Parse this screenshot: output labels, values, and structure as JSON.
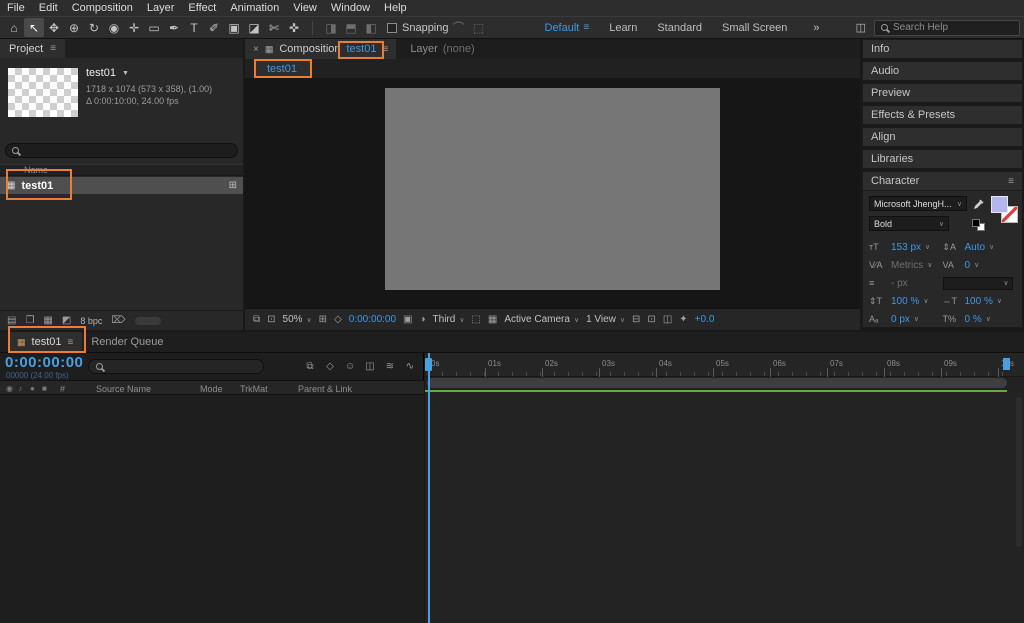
{
  "colors": {
    "accent_blue": "#3f97e5",
    "annotation_orange": "#ed7d31",
    "comp_background_gray": "#767676",
    "cache_green": "#5ab235",
    "fill_swatch": "#b4b4ee"
  },
  "icons": {
    "menu": "≡",
    "close": "×",
    "chevron": "∨",
    "triangle_down": "▼",
    "comp": "▦",
    "folder": "❐",
    "footage": "▤",
    "adjust": "◩",
    "trash": "⌦",
    "screen": "⧉",
    "monitor": "⊡",
    "grid": "⊞",
    "mask": "◇",
    "camera": "▣",
    "channels": "◑",
    "roi": "⬚",
    "share": "⊟",
    "pixel_aspect": "◫",
    "fast": "✦",
    "eye": "◉",
    "audio": "♪",
    "solo": "●",
    "lock": "■",
    "font_size": "тT",
    "leading": "⇕A",
    "kerning": "V∕A",
    "tracking": "VA",
    "stroke_width": "≡",
    "vertical_scale": "⇕T",
    "horizontal_scale": "⇔T",
    "baseline_shift": "Aₐ",
    "tsume": "T%"
  },
  "menu_bar": {
    "items": [
      "File",
      "Edit",
      "Composition",
      "Layer",
      "Effect",
      "Animation",
      "View",
      "Window",
      "Help"
    ]
  },
  "toolbar": {
    "tools": [
      {
        "name": "home-tool",
        "glyph": "⌂",
        "active": false
      },
      {
        "name": "selection-tool",
        "glyph": "↖",
        "active": true
      },
      {
        "name": "hand-tool",
        "glyph": "✥",
        "active": false
      },
      {
        "name": "zoom-tool",
        "glyph": "⊕",
        "active": false
      },
      {
        "name": "rotate-tool",
        "glyph": "↻",
        "active": false
      },
      {
        "name": "camera-tool",
        "glyph": "◉",
        "active": false
      },
      {
        "name": "pan-behind-tool",
        "glyph": "✛",
        "active": false
      },
      {
        "name": "rectangle-tool",
        "glyph": "▭",
        "active": false
      },
      {
        "name": "pen-tool",
        "glyph": "✒",
        "active": false
      },
      {
        "name": "type-tool",
        "glyph": "T",
        "active": false
      },
      {
        "name": "brush-tool",
        "glyph": "✐",
        "active": false
      },
      {
        "name": "clone-stamp-tool",
        "glyph": "▣",
        "active": false
      },
      {
        "name": "eraser-tool",
        "glyph": "◪",
        "active": false
      },
      {
        "name": "roto-brush-tool",
        "glyph": "✄",
        "active": false
      },
      {
        "name": "puppet-pin-tool",
        "glyph": "✜",
        "active": false
      }
    ],
    "option_icons": [
      {
        "name": "fill-options-icon",
        "glyph": "◨"
      },
      {
        "name": "stroke-options-icon",
        "glyph": "⬒"
      },
      {
        "name": "mask-options-icon",
        "glyph": "◧"
      }
    ],
    "snapping_label": "Snapping",
    "snap_icons": [
      {
        "name": "snap-along-edges-icon",
        "glyph": "⌒"
      },
      {
        "name": "snap-features-icon",
        "glyph": "⬚"
      }
    ],
    "workspaces": [
      {
        "label": "Default",
        "active": true
      },
      {
        "label": "Learn",
        "active": false
      },
      {
        "label": "Standard",
        "active": false
      },
      {
        "label": "Small Screen",
        "active": false
      }
    ],
    "workspace_overflow": "»",
    "search": {
      "placeholder": "Search Help"
    }
  },
  "project_panel": {
    "tab": "Project",
    "selected_item": {
      "name": "test01"
    },
    "details": [
      "1718 x 1074  (573 x 358), (1.00)",
      "Δ 0:00:10:00, 24.00 fps"
    ],
    "name_column": "Name",
    "rows": [
      {
        "name": "test01",
        "type": "composition"
      }
    ],
    "bit_depth": "8 bpc"
  },
  "composition_panel": {
    "tab_label": "Composition",
    "tab_comp_name": "test01",
    "layer_tab_label": "Layer",
    "layer_tab_value": "(none)",
    "viewer_tab": "test01",
    "zoom": "50%",
    "timecode": "0:00:00:00",
    "resolution": "Third",
    "camera": "Active Camera",
    "view_layout": "1 View",
    "exposure": "+0.0"
  },
  "right_panels": {
    "collapsed": [
      "Info",
      "Audio",
      "Preview",
      "Effects & Presets",
      "Align",
      "Libraries"
    ]
  },
  "character_panel": {
    "title": "Character",
    "font_family": "Microsoft JhengH...",
    "font_style": "Bold",
    "font_size": "153 px",
    "leading": "Auto",
    "kerning": "Metrics",
    "tracking": "0",
    "stroke_width": "- px",
    "vertical_scale": "100 %",
    "horizontal_scale": "100 %",
    "baseline_shift": "0 px",
    "tsume": "0 %"
  },
  "timeline": {
    "comp_tab": "test01",
    "render_queue_tab": "Render Queue",
    "timecode": "0:00:00:00",
    "frame_info": "00000 (24.00 fps)",
    "feature_icons": [
      {
        "name": "composition-mini-flowchart-icon",
        "glyph": "⧉"
      },
      {
        "name": "draft-3d-icon",
        "glyph": "◇"
      },
      {
        "name": "hide-shy-layers-icon",
        "glyph": "☺"
      },
      {
        "name": "frame-blending-icon",
        "glyph": "◫"
      },
      {
        "name": "motion-blur-icon",
        "glyph": "≋"
      },
      {
        "name": "graph-editor-icon",
        "glyph": "∿"
      }
    ],
    "columns": {
      "hash": "#",
      "source_name": "Source Name",
      "mode": "Mode",
      "trkmat": "TrkMat",
      "parent": "Parent & Link"
    },
    "ruler_ticks": [
      "0s",
      "01s",
      "02s",
      "03s",
      "04s",
      "05s",
      "06s",
      "07s",
      "08s",
      "09s",
      "10s"
    ]
  },
  "annotations": [
    {
      "name": "annotation-comp-tab-name"
    },
    {
      "name": "annotation-viewer-tab"
    },
    {
      "name": "annotation-project-item"
    },
    {
      "name": "annotation-timeline-tab"
    }
  ]
}
